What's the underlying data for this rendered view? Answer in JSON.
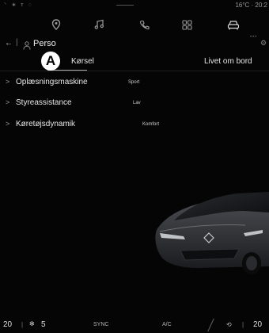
{
  "status_bar": {
    "icons_text": "⸌ ∗ ᴛ ◌",
    "temperature_time": "16°C · 20:2"
  },
  "top_nav": {
    "items": [
      "map-pin-icon",
      "music-note-icon",
      "phone-icon",
      "apps-grid-icon",
      "car-icon"
    ],
    "active": "car-icon"
  },
  "header": {
    "title": "Perso"
  },
  "tabs": [
    "Kørsel",
    "Livet om bord"
  ],
  "active_tab": "Kørsel",
  "marker_label": "A",
  "settings": [
    {
      "label": "Oplæsningsmaskine",
      "value": "Sport"
    },
    {
      "label": "Styreassistance",
      "value": "Lav"
    },
    {
      "label": "Køretøjsdynamik",
      "value": "Komfort"
    }
  ],
  "bottom_bar": {
    "temp_left": "20",
    "fan_level": "5",
    "sync_label": "SYNC",
    "ac_label": "A/C",
    "temp_right": "20"
  },
  "colors": {
    "background": "#050505",
    "text": "#ffffff",
    "muted": "#9a9a9a"
  }
}
